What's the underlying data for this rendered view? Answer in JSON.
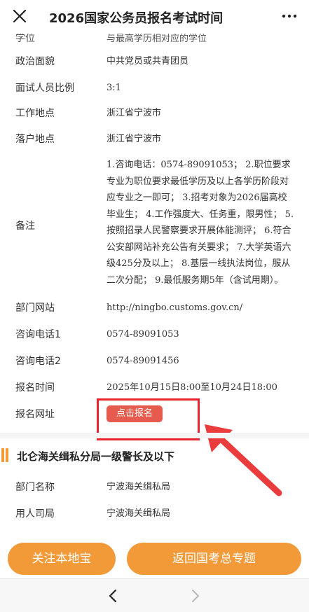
{
  "header": {
    "title": "2026国家公务员报名考试时间"
  },
  "cut_row": {
    "label": "学位",
    "value": "与最高学历相对应的学位"
  },
  "rows": [
    {
      "label": "政治面貌",
      "value": "中共党员或共青团员"
    },
    {
      "label": "面试人员比例",
      "value": "3:1"
    },
    {
      "label": "工作地点",
      "value": "浙江省宁波市"
    },
    {
      "label": "落户地点",
      "value": "浙江省宁波市"
    },
    {
      "label": "备注",
      "value": "1.咨询电话：0574-89091053； 2.职位要求专业为职位要求最低学历及以上各学历阶段对应专业之一即可； 3.招考对象为2026届高校毕业生； 4.工作强度大、任务重，限男性； 5.按照招录人民警察要求开展体能测评； 6.符合公安部网站补充公告有关要求； 7.大学英语六级425分及以上； 8.基层一线执法岗位，服从二次分配； 9.最低服务期5年（含试用期）。"
    },
    {
      "label": "部门网站",
      "value": "http://ningbo.customs.gov.cn/"
    },
    {
      "label": "咨询电话1",
      "value": "0574-89091053"
    },
    {
      "label": "咨询电话2",
      "value": "0574-89091456"
    },
    {
      "label": "报名时间",
      "value": "2025年10月15日8:00至10月24日18:00"
    },
    {
      "label": "报名网址",
      "value": ""
    }
  ],
  "register_button": "点击报名",
  "section": {
    "title": "北仑海关缉私分局一级警长及以下",
    "rows": [
      {
        "label": "部门名称",
        "value": "宁波海关缉私局"
      },
      {
        "label": "用人司局",
        "value": "宁波海关缉私局"
      }
    ]
  },
  "bottom": {
    "follow_label": "关注本地宝",
    "back_label": "返回国考总专题"
  },
  "colors": {
    "accent_orange": "#f29a38",
    "register_red": "#e65b4d",
    "highlight_red": "#e8232f"
  }
}
